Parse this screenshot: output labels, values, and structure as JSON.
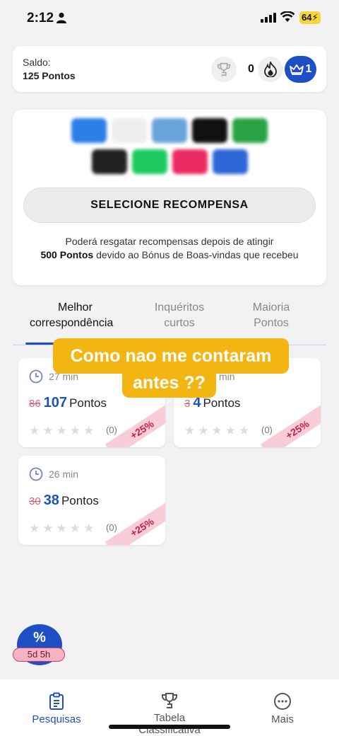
{
  "status_bar": {
    "time": "2:12",
    "battery": "64"
  },
  "balance": {
    "label": "Saldo:",
    "value": "125 Pontos",
    "streak": "0",
    "crown_count": "1"
  },
  "rewards": {
    "logos": [
      [
        "#2d7ee6",
        "#eeeeee",
        "#6aa4d8",
        "#111111",
        "#2aa345"
      ],
      [
        "#222222",
        "#1ec960",
        "#ea2a63",
        "#2d67d6"
      ]
    ],
    "select_label": "SELECIONE RECOMPENSA",
    "note_before": "Poderá resgatar recompensas depois de atingir",
    "note_bold": "500 Pontos",
    "note_after": " devido ao Bónus de Boas-vindas  que recebeu"
  },
  "tabs": [
    {
      "line1": "Melhor",
      "line2": "correspondência"
    },
    {
      "line1": "Inquéritos",
      "line2": "curtos"
    },
    {
      "line1": "Maioria",
      "line2": "Pontos"
    }
  ],
  "surveys": [
    {
      "duration": "27 min",
      "old_points": "86",
      "new_points": "107",
      "unit": "Pontos",
      "rating_count": "(0)",
      "bonus": "+25%"
    },
    {
      "duration": "min",
      "old_points": "3",
      "new_points": "4",
      "unit": "Pontos",
      "rating_count": "(0)",
      "bonus": "+25%"
    },
    {
      "duration": "26 min",
      "old_points": "30",
      "new_points": "38",
      "unit": "Pontos",
      "rating_count": "(0)",
      "bonus": "+25%"
    }
  ],
  "caption": {
    "line1": "Como nao me contaram",
    "line2": "antes ??"
  },
  "promo": {
    "symbol": "%",
    "timer": "5d 5h"
  },
  "nav": [
    {
      "label": "Pesquisas"
    },
    {
      "label": "Tabela",
      "label2": "Classificativa"
    },
    {
      "label": "Mais"
    }
  ],
  "colors": {
    "accent": "#1f4fc4",
    "caption_bg": "#f2b511",
    "bonus": "#c4204d"
  }
}
